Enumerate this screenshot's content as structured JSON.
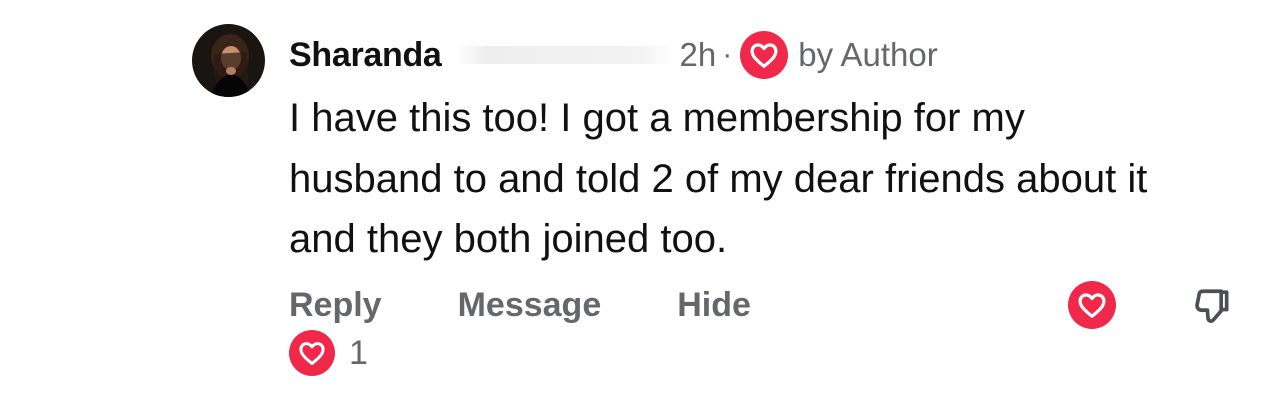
{
  "comment": {
    "author": "Sharanda",
    "time": "2h",
    "separator": "·",
    "author_like_label": "by Author",
    "body": "I have this too! I got a membership for my husband to and told 2 of my dear friends about it and they both joined too.",
    "reaction_count": "1"
  },
  "actions": {
    "reply": "Reply",
    "message": "Message",
    "hide": "Hide"
  },
  "icons": {
    "author_heart": "heart-icon",
    "like": "heart-icon",
    "dislike": "thumbs-down-icon",
    "reaction": "heart-icon"
  },
  "colors": {
    "heart_red": "#f0284a",
    "secondary_text": "#65676b",
    "primary_text": "#111111"
  }
}
